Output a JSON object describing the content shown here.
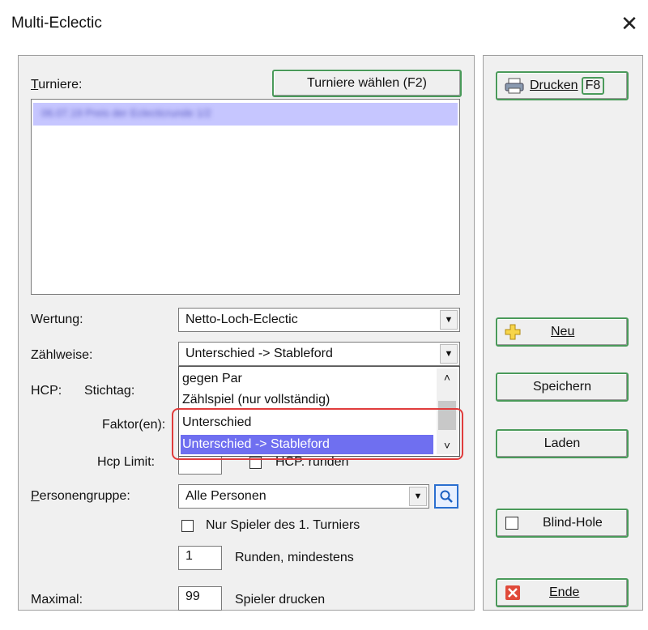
{
  "window": {
    "title": "Multi-Eclectic",
    "close_symbol": "✕"
  },
  "turniere": {
    "label_u": "T",
    "label_rest": "urniere:",
    "select_button": "Turniere wählen (F2)",
    "selected_item_blurred": "06.07.19 Preis der Eclecticrunde 1/2"
  },
  "wertung": {
    "label": "Wertung:",
    "value": "Netto-Loch-Eclectic"
  },
  "zaehlweise": {
    "label": "Zählweise:",
    "value": "Unterschied -> Stableford"
  },
  "dropdown": {
    "options": [
      "gegen Par",
      "Zählspiel (nur vollständig)",
      "Unterschied",
      "Unterschied -> Stableford"
    ],
    "selected_index": 3
  },
  "hcp": {
    "label": "HCP:",
    "stichtag_label": "Stichtag:",
    "faktor_label": "Faktor(en):",
    "limit_label": "Hcp Limit:",
    "runden_label": "HCP. runden"
  },
  "personengruppe": {
    "label": "Personengruppe:",
    "value": "Alle Personen"
  },
  "nur_spieler": {
    "label": "Nur Spieler des 1. Turniers"
  },
  "runden": {
    "value": "1",
    "label": "Runden, mindestens"
  },
  "maximal": {
    "label": "Maximal:",
    "value": "99",
    "suffix": "Spieler drucken"
  },
  "sidebar": {
    "drucken": "Drucken",
    "drucken_key": "F8",
    "neu": "Neu",
    "speichern": "Speichern",
    "laden": "Laden",
    "blind_hole": "Blind-Hole",
    "ende": "Ende"
  },
  "colors": {
    "highlight": "#c6c6ff",
    "dropdown_select": "#6f6ff0",
    "annotation": "#e03c3c",
    "button_border": "#4a9a5a"
  }
}
